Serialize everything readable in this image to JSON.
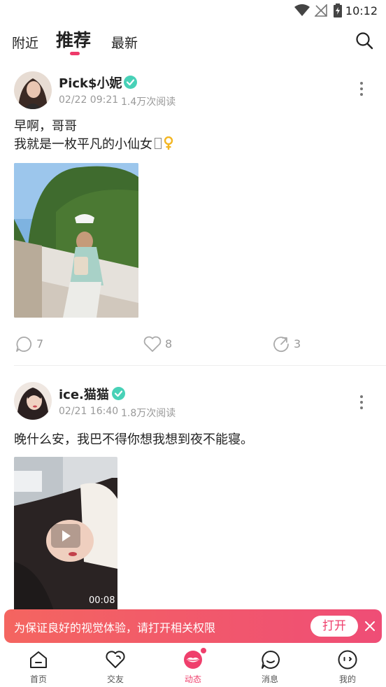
{
  "status_bar": {
    "time": "10:12"
  },
  "tabs": [
    {
      "label": "附近"
    },
    {
      "label": "推荐"
    },
    {
      "label": "最新"
    }
  ],
  "posts": [
    {
      "username": "Pick$小妮",
      "datetime": "02/22 09:21",
      "reads": "1.4万次阅读",
      "content_line1": "早啊，哥哥",
      "content_line2": "我就是一枚平凡的小仙女",
      "comments": "7",
      "likes": "8",
      "shares": "3"
    },
    {
      "username": "ice.猫猫",
      "datetime": "02/21 16:40",
      "reads": "1.8万次阅读",
      "content_line1": "晚什么安，我巴不得你想我想到夜不能寝。",
      "video_duration": "00:08"
    }
  ],
  "banner": {
    "text": "为保证良好的视觉体验，请打开相关权限",
    "button": "打开"
  },
  "nav": [
    {
      "label": "首页"
    },
    {
      "label": "交友"
    },
    {
      "label": "动态"
    },
    {
      "label": "消息"
    },
    {
      "label": "我的"
    }
  ],
  "colors": {
    "accent": "#ef3f6c",
    "verified": "#48d1b7"
  }
}
